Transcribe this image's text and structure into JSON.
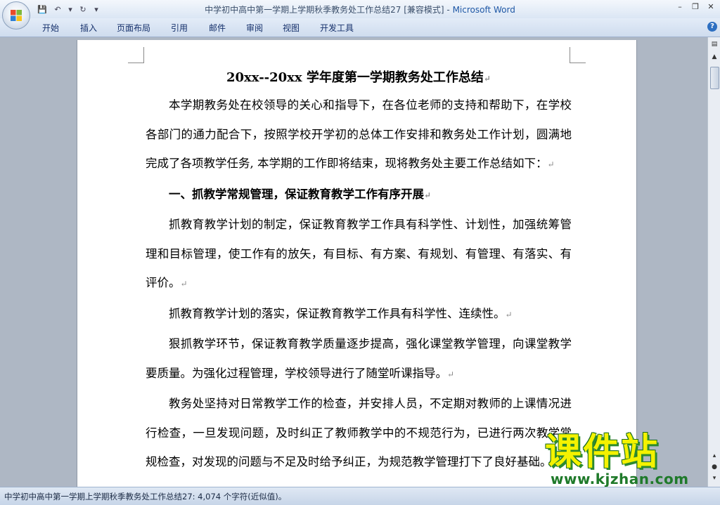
{
  "window": {
    "title": "中学初中高中第一学期上学期秋季教务处工作总结27 [兼容模式]",
    "separator": " - ",
    "app_name": "Microsoft Word",
    "controls": {
      "minimize": "–",
      "restore": "❐",
      "close": "✕"
    }
  },
  "qat": {
    "save_icon": "💾",
    "undo_icon": "↶",
    "undo_dd": "▾",
    "redo_icon": "↻",
    "customize": "▾"
  },
  "tabs": [
    {
      "label": "开始"
    },
    {
      "label": "插入"
    },
    {
      "label": "页面布局"
    },
    {
      "label": "引用"
    },
    {
      "label": "邮件"
    },
    {
      "label": "审阅"
    },
    {
      "label": "视图"
    },
    {
      "label": "开发工具"
    }
  ],
  "help_label": "?",
  "document": {
    "title": "20xx--20xx 学年度第一学期教务处工作总结",
    "paragraph_mark": "↵",
    "paragraphs": [
      {
        "type": "p",
        "text": "本学期教务处在校领导的关心和指导下，在各位老师的支持和帮助下，在学校各部门的通力配合下，按照学校开学初的总体工作安排和教务处工作计划，圆满地完成了各项教学任务, 本学期的工作即将结束，现将教务处主要工作总结如下："
      },
      {
        "type": "h1",
        "text": "一、抓教学常规管理，保证教育教学工作有序开展"
      },
      {
        "type": "p",
        "text": "抓教育教学计划的制定，保证教育教学工作具有科学性、计划性，加强统筹管理和目标管理，使工作有的放矢，有目标、有方案、有规划、有管理、有落实、有评价。"
      },
      {
        "type": "p",
        "text": "抓教育教学计划的落实，保证教育教学工作具有科学性、连续性。"
      },
      {
        "type": "p",
        "text": "狠抓教学环节，保证教育教学质量逐步提高，强化课堂教学管理，向课堂教学要质量。为强化过程管理，学校领导进行了随堂听课指导。"
      },
      {
        "type": "p",
        "text": "教务处坚持对日常教学工作的检查，并安排人员，不定期对教师的上课情况进行检查，一旦发现问题，及时纠正了教师教学中的不规范行为，已进行两次教学常规检查，对发现的问题与不足及时给予纠正，为规范教学管理打下了良好基础。"
      }
    ]
  },
  "scrollbar": {
    "up": "▲",
    "down": "▼",
    "page_up": "▴",
    "page_down": "▾"
  },
  "watermark": {
    "main": "课件站",
    "url": "www.kjzhan.com"
  },
  "status_bar": {
    "text": "中学初中高中第一学期上学期秋季教务处工作总结27: 4,074 个字符(近似值)。"
  }
}
